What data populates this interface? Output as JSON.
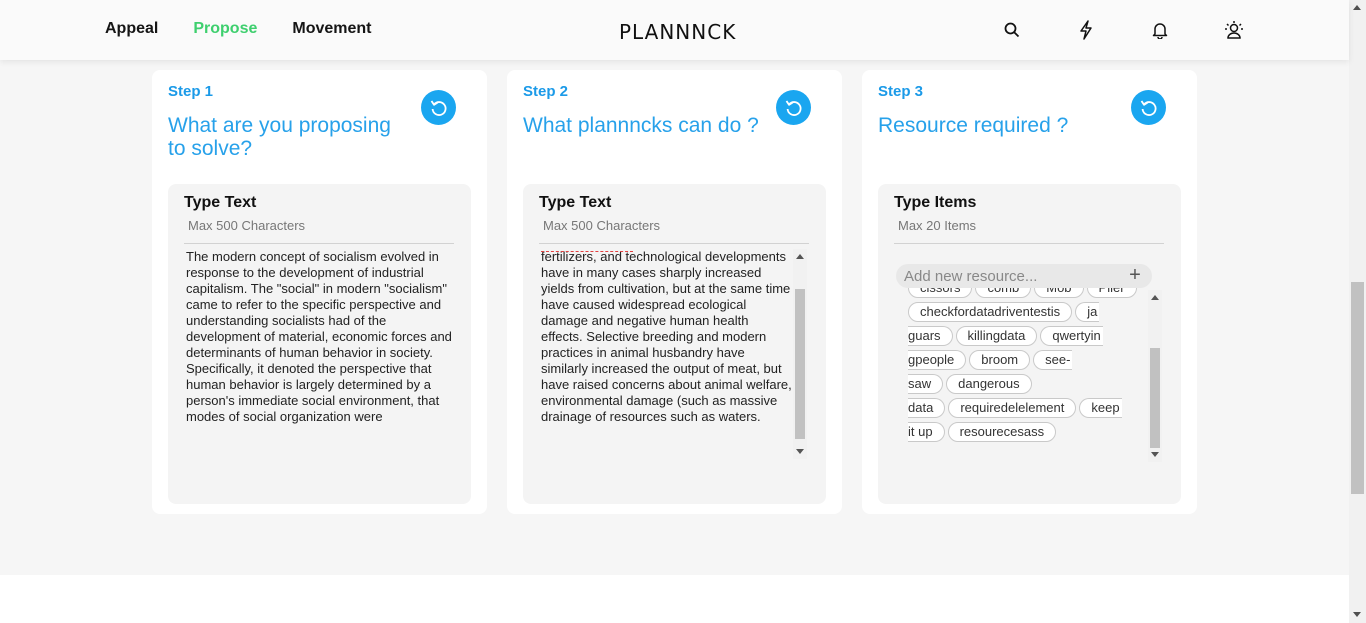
{
  "nav": {
    "items": [
      "Appeal",
      "Propose",
      "Movement"
    ],
    "active": "Propose"
  },
  "logo": "PLANNNCK",
  "header_icons": [
    "search-icon",
    "lightning-icon",
    "bell-icon",
    "user-sun-icon"
  ],
  "colors": {
    "accent_blue": "#1aa6f0",
    "active_green": "#3ecf6e",
    "title_blue": "#27a1ea"
  },
  "step1": {
    "step": "Step 1",
    "title": "What are you proposing to solve?",
    "field_title": "Type Text",
    "field_hint": "Max 500 Characters",
    "text": "The modern concept of socialism evolved in response to the development of industrial capitalism. The \"social\" in modern \"socialism\" came to refer to the specific perspective and understanding socialists had of the development of material, economic forces and determinants of human behavior in society. Specifically, it denoted the perspective that human behavior is largely determined by a person's immediate social environment, that modes of social organization were"
  },
  "step2": {
    "step": "Step 2",
    "title": "What plannncks can do ?",
    "field_title": "Type Text",
    "field_hint": "Max 500 Characters",
    "text": "fertilizers, and technological developments have in many cases sharply increased yields from cultivation, but at the same time have caused widespread ecological damage and negative human health effects. Selective breeding and modern practices in animal husbandry have similarly increased the output of meat, but have raised concerns about animal welfare, environmental damage (such as massive drainage of resources such as waters."
  },
  "step3": {
    "step": "Step 3",
    "title": "Resource required ?",
    "field_title": "Type Items",
    "field_hint": "Max 20 Items",
    "input_placeholder": "Add new resource...",
    "chip_rows": [
      [
        {
          "t": "cissors"
        },
        {
          "t": "comb"
        },
        {
          "t": "Mob"
        },
        {
          "t": "Plier"
        }
      ],
      [
        {
          "t": "checkfordatadriventestis"
        },
        {
          "t": "ja",
          "brk": true
        }
      ],
      [
        {
          "t": "guars",
          "cont": true
        },
        {
          "t": "killingdata"
        },
        {
          "t": "qwertyin",
          "brk": true
        }
      ],
      [
        {
          "t": "gpeople",
          "cont": true
        },
        {
          "t": "broom"
        },
        {
          "t": "see-",
          "brk": true
        }
      ],
      [
        {
          "t": "saw",
          "cont": true
        },
        {
          "t": "dangerous"
        }
      ],
      [
        {
          "t": "data",
          "cont": true
        },
        {
          "t": "requiredelelement"
        },
        {
          "t": "keep",
          "brk": true
        }
      ],
      [
        {
          "t": "it up",
          "cont": true
        },
        {
          "t": "resourecesass"
        }
      ]
    ]
  }
}
